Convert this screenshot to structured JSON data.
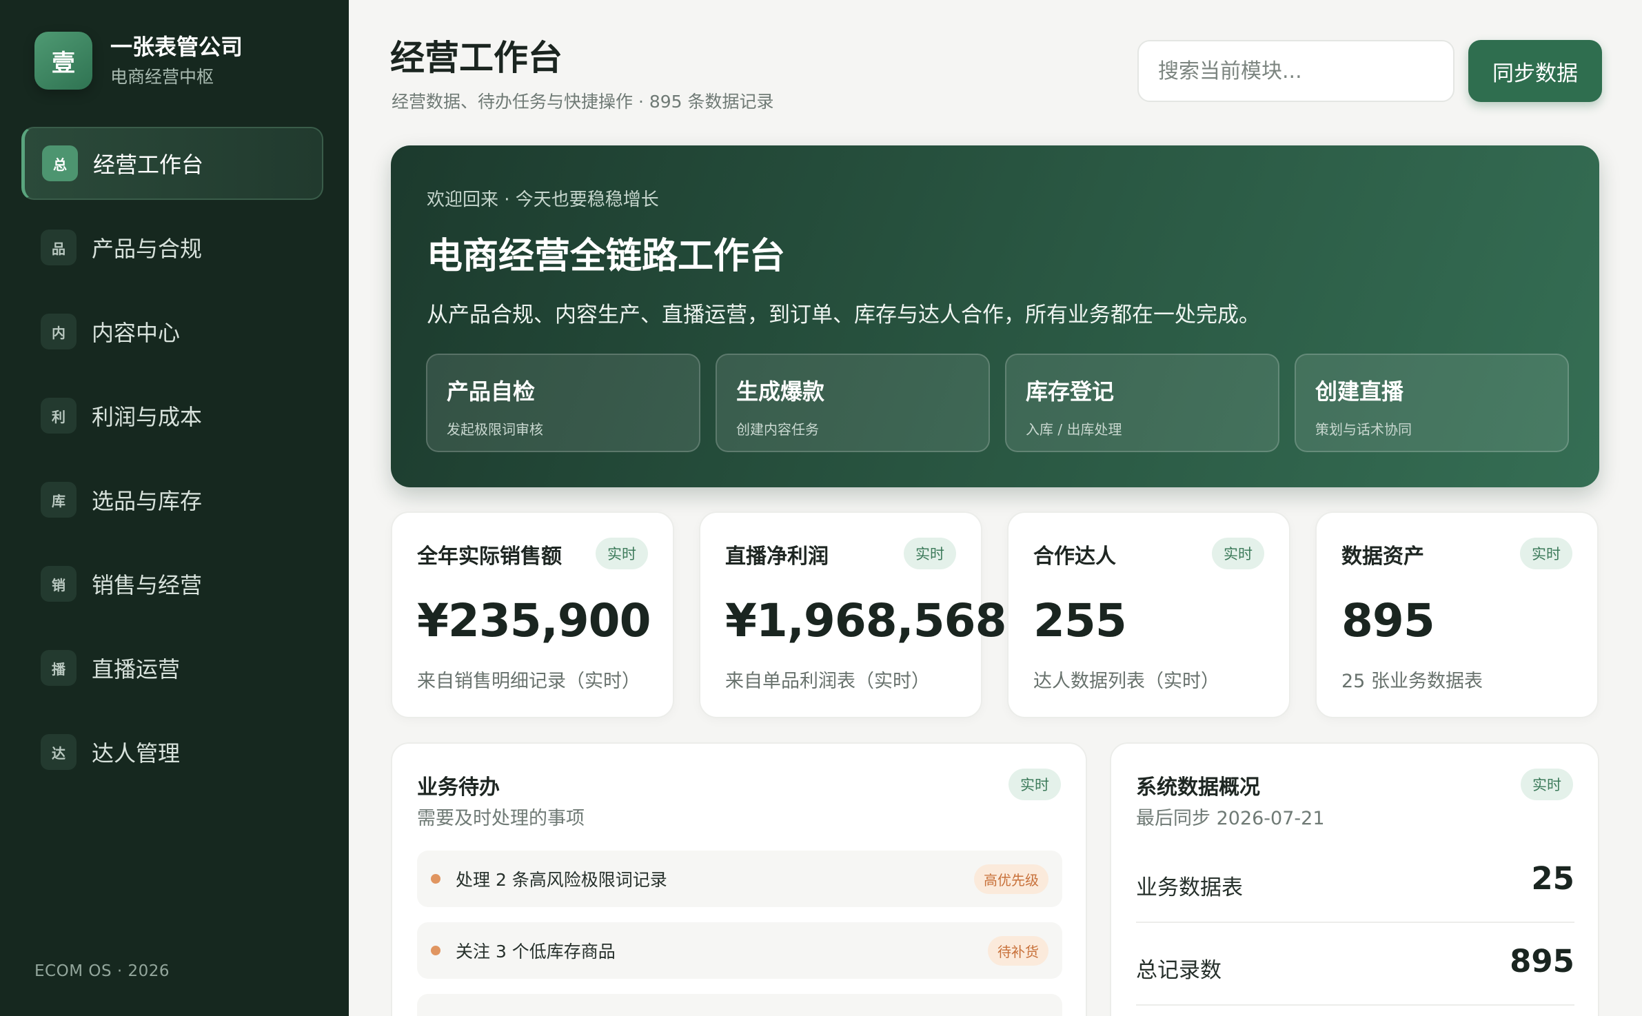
{
  "sidebar": {
    "brand_logo": "壹",
    "brand_name": "一张表管公司",
    "brand_sub": "电商经营中枢",
    "items": [
      {
        "badge": "总",
        "label": "经营工作台",
        "active": true
      },
      {
        "badge": "品",
        "label": "产品与合规"
      },
      {
        "badge": "内",
        "label": "内容中心"
      },
      {
        "badge": "利",
        "label": "利润与成本"
      },
      {
        "badge": "库",
        "label": "选品与库存"
      },
      {
        "badge": "销",
        "label": "销售与经营"
      },
      {
        "badge": "播",
        "label": "直播运营"
      },
      {
        "badge": "达",
        "label": "达人管理"
      }
    ],
    "footer": "ECOM OS · 2026"
  },
  "header": {
    "title": "经营工作台",
    "subtitle": "经营数据、待办任务与快捷操作 · 895 条数据记录",
    "search_placeholder": "搜索当前模块...",
    "sync_label": "同步数据"
  },
  "hero": {
    "welcome": "欢迎回来 · 今天也要稳稳增长",
    "title": "电商经营全链路工作台",
    "desc": "从产品合规、内容生产、直播运营，到订单、库存与达人合作，所有业务都在一处完成。",
    "actions": [
      {
        "title": "产品自检",
        "sub": "发起极限词审核"
      },
      {
        "title": "生成爆款",
        "sub": "创建内容任务"
      },
      {
        "title": "库存登记",
        "sub": "入库 / 出库处理"
      },
      {
        "title": "创建直播",
        "sub": "策划与话术协同"
      }
    ]
  },
  "stats": [
    {
      "label": "全年实际销售额",
      "tag": "实时",
      "value": "¥235,900",
      "note": "来自销售明细记录（实时）"
    },
    {
      "label": "直播净利润",
      "tag": "实时",
      "value": "¥1,968,568",
      "note": "来自单品利润表（实时）"
    },
    {
      "label": "合作达人",
      "tag": "实时",
      "value": "255",
      "note": "达人数据列表（实时）"
    },
    {
      "label": "数据资产",
      "tag": "实时",
      "value": "895",
      "note": "25 张业务数据表"
    }
  ],
  "todo": {
    "title": "业务待办",
    "subtitle": "需要及时处理的事项",
    "tag": "实时",
    "items": [
      {
        "text": "处理 2 条高风险极限词记录",
        "priority": "高优先级"
      },
      {
        "text": "关注 3 个低库存商品",
        "priority": "待补货"
      }
    ]
  },
  "system": {
    "title": "系统数据概况",
    "subtitle": "最后同步 2026-07-21",
    "tag": "实时",
    "rows": [
      {
        "label": "业务数据表",
        "value": "25"
      },
      {
        "label": "总记录数",
        "value": "895"
      }
    ]
  },
  "colors": {
    "sidebar_bg": "#16281f",
    "accent": "#2f6e4f",
    "warn": "#e09560"
  }
}
